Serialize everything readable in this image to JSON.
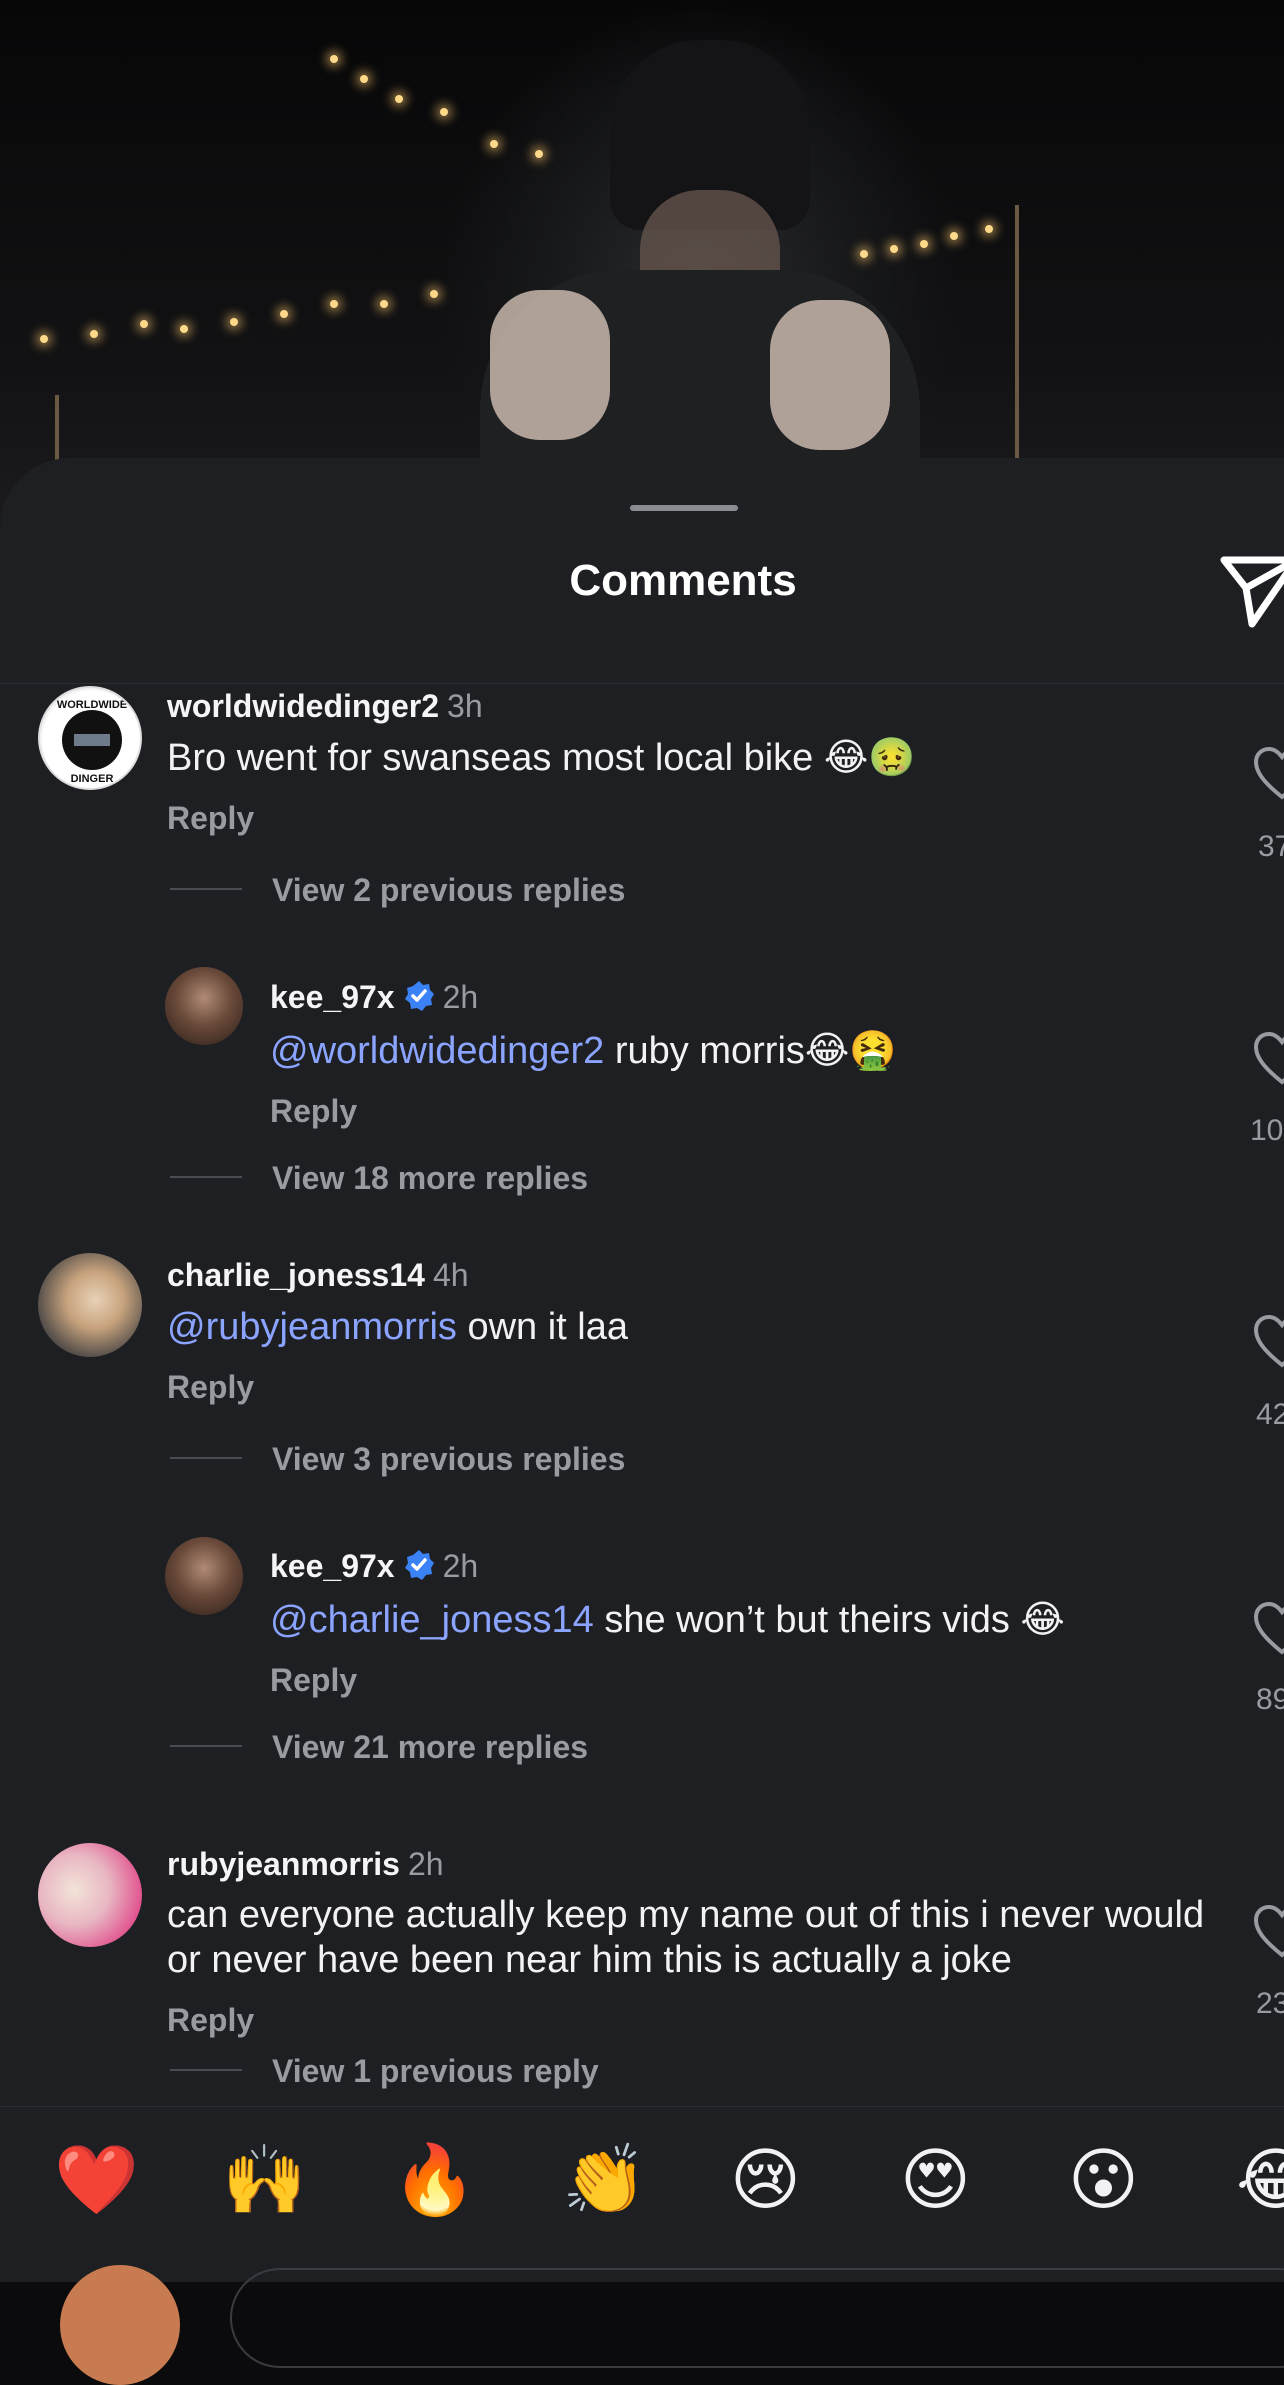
{
  "sheet": {
    "title": "Comments"
  },
  "comments": [
    {
      "username": "worldwidedinger2",
      "time": "3h",
      "mention": "",
      "text": "Bro went for swanseas most local bike 😂🤢",
      "reply": "Reply",
      "likes": "37",
      "view_replies": "View 2 previous replies",
      "avatar_text": "WORLDWIDE DINGER"
    },
    {
      "username": "kee_97x",
      "time": "2h",
      "mention": "@worldwidedinger2",
      "text": " ruby morris😂🤮",
      "reply": "Reply",
      "likes": "10",
      "view_replies": "View 18 more replies"
    },
    {
      "username": "charlie_joness14",
      "time": "4h",
      "mention": "@rubyjeanmorris",
      "text": " own it laa",
      "reply": "Reply",
      "likes": "42",
      "view_replies": "View 3 previous replies"
    },
    {
      "username": "kee_97x",
      "time": "2h",
      "mention": "@charlie_joness14",
      "text": " she won’t but theirs vids 😂",
      "reply": "Reply",
      "likes": "89",
      "view_replies": "View 21 more replies"
    },
    {
      "username": "rubyjeanmorris",
      "time": "2h",
      "mention": "",
      "text": "can everyone actually keep my name out of this i never would or never have been near him this is actually a joke",
      "reply": "Reply",
      "likes": "23",
      "view_replies": "View 1 previous reply"
    }
  ],
  "emoji_bar": [
    "❤️",
    "🙌",
    "🔥",
    "👏",
    "😢",
    "😍",
    "😮",
    "😂"
  ],
  "colors": {
    "sheet_bg": "#1e1f23",
    "mention": "#8aa4ff",
    "muted": "#9a9ba1",
    "verified": "#3b82f6"
  }
}
